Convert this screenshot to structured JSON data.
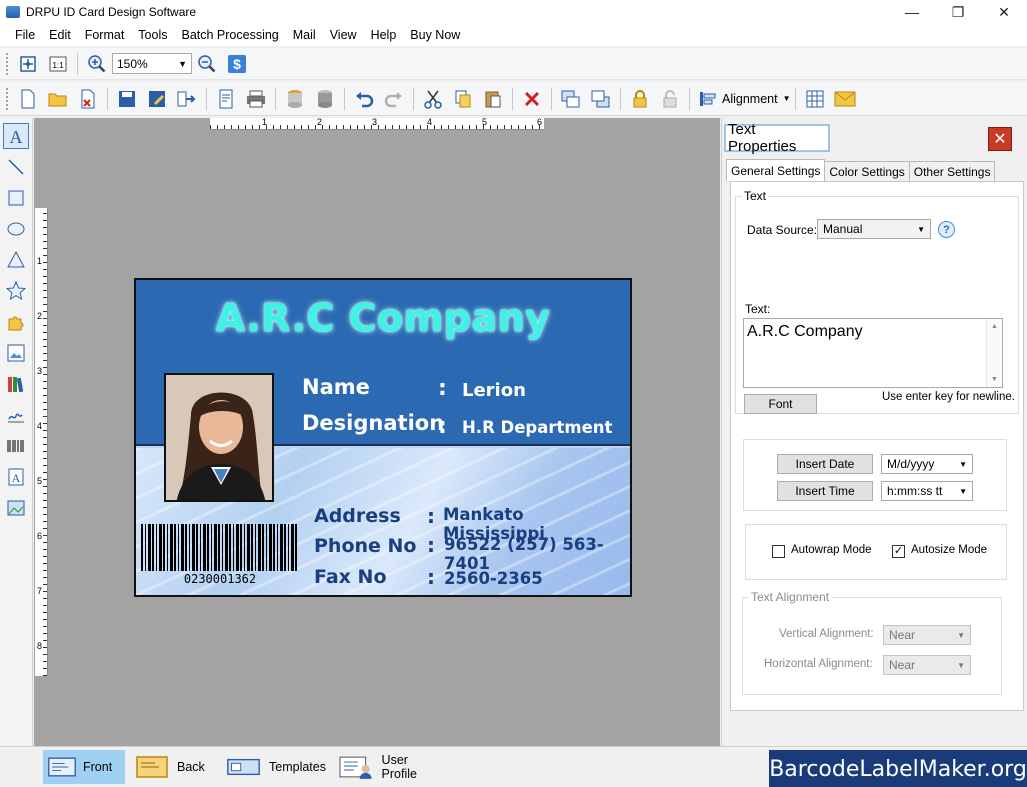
{
  "window": {
    "title": "DRPU ID Card Design Software"
  },
  "menu": [
    "File",
    "Edit",
    "Format",
    "Tools",
    "Batch Processing",
    "Mail",
    "View",
    "Help",
    "Buy Now"
  ],
  "toolbar": {
    "zoom_value": "150%",
    "alignment_label": "Alignment"
  },
  "ruler": {
    "h_marks": [
      "1",
      "2",
      "3",
      "4",
      "5",
      "6"
    ],
    "v_marks": [
      "1",
      "2",
      "3",
      "4",
      "5",
      "6",
      "7",
      "8"
    ]
  },
  "card": {
    "company": "A.R.C Company",
    "name_label": "Name",
    "name_colon": ":",
    "name_value": "Lerion",
    "designation_label": "Designation",
    "designation_colon": ":",
    "designation_value": "H.R Department",
    "address_label": "Address",
    "address_colon": ":",
    "address_value": "Mankato Mississippi",
    "phone_label": "Phone No",
    "phone_colon": ":",
    "phone_value": "96522 (257) 563-7401",
    "fax_label": "Fax No",
    "fax_colon": ":",
    "fax_value": "2560-2365",
    "barcode_number": "0230001362"
  },
  "panel": {
    "title": "Text Properties",
    "tabs": [
      "General Settings",
      "Color Settings",
      "Other Settings"
    ],
    "text_group_title": "Text",
    "data_source_label": "Data Source:",
    "data_source_value": "Manual",
    "help_symbol": "?",
    "text_label": "Text:",
    "text_value": "A.R.C Company",
    "font_button": "Font",
    "newline_hint": "Use enter key for newline.",
    "insert_date_button": "Insert Date",
    "date_format": "M/d/yyyy",
    "insert_time_button": "Insert Time",
    "time_format": "h:mm:ss tt",
    "autowrap_label": "Autowrap Mode",
    "autowrap_checked": false,
    "autosize_label": "Autosize Mode",
    "autosize_checked": true,
    "autosize_mark": "✓",
    "alignment_group_title": "Text Alignment",
    "vertical_alignment_label": "Vertical Alignment:",
    "vertical_alignment_value": "Near",
    "horizontal_alignment_label": "Horizontal  Alignment:",
    "horizontal_alignment_value": "Near"
  },
  "bottom": {
    "tabs": [
      "Front",
      "Back",
      "Templates",
      "User Profile"
    ],
    "brand": "BarcodeLabelMaker.org"
  },
  "colors": {
    "card_header": "#2b6ab2",
    "company_text": "#3ef2e4",
    "brand_bg": "#1a3b7a",
    "close_button": "#c73a24"
  }
}
